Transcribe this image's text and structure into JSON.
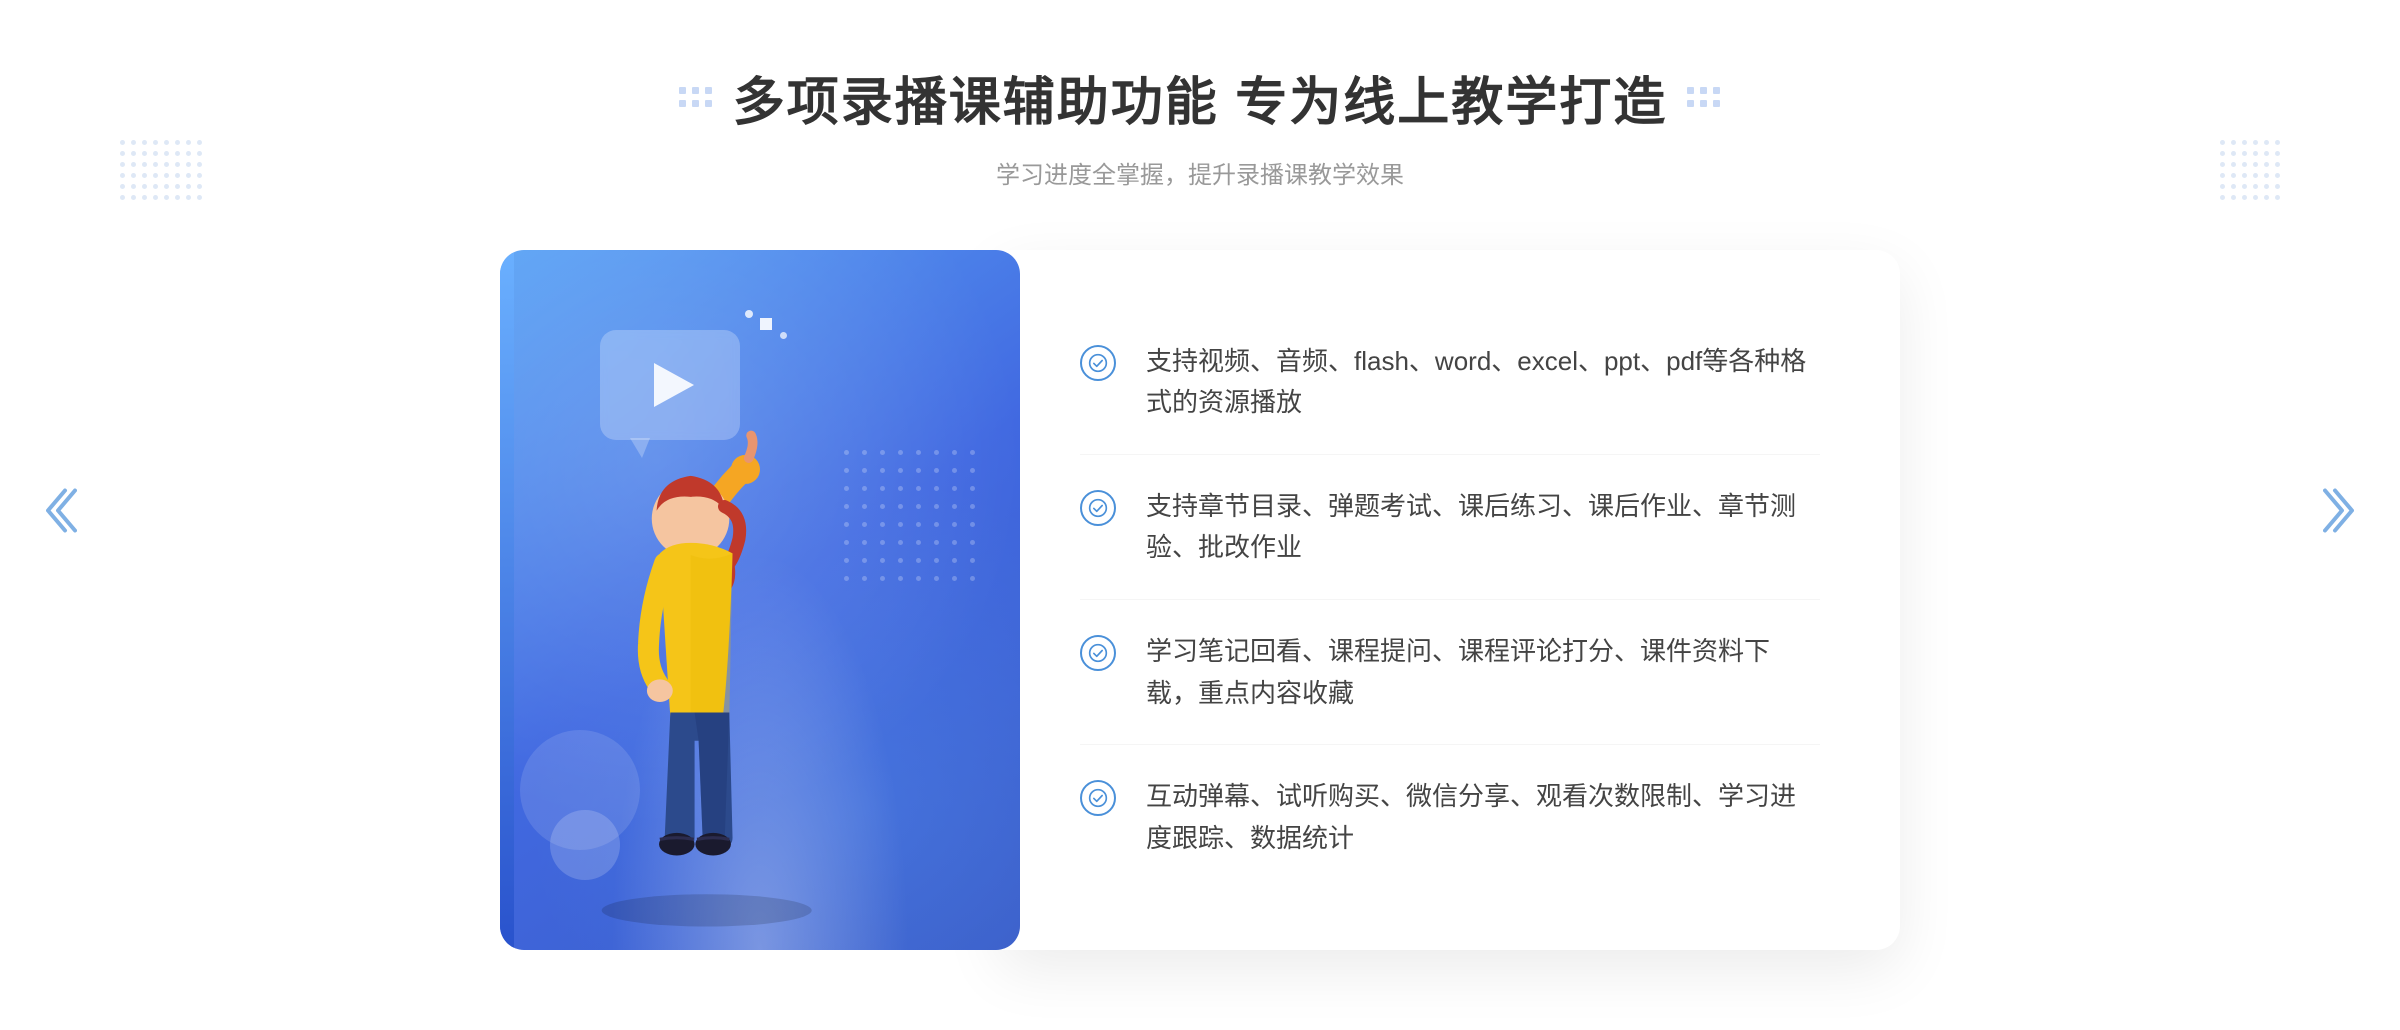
{
  "page": {
    "background": "#ffffff"
  },
  "header": {
    "title": "多项录播课辅助功能 专为线上教学打造",
    "subtitle": "学习进度全掌握，提升录播课教学效果",
    "title_deco_left": "⁞",
    "title_deco_right": "⁞"
  },
  "features": [
    {
      "id": 1,
      "text": "支持视频、音频、flash、word、excel、ppt、pdf等各种格式的资源播放"
    },
    {
      "id": 2,
      "text": "支持章节目录、弹题考试、课后练习、课后作业、章节测验、批改作业"
    },
    {
      "id": 3,
      "text": "学习笔记回看、课程提问、课程评论打分、课件资料下载，重点内容收藏"
    },
    {
      "id": 4,
      "text": "互动弹幕、试听购买、微信分享、观看次数限制、学习进度跟踪、数据统计"
    }
  ],
  "colors": {
    "accent_blue": "#4a90d9",
    "gradient_start": "#5ba3f5",
    "gradient_end": "#3a5bc7",
    "text_dark": "#333333",
    "text_light": "#999999",
    "feature_text": "#444444"
  },
  "illustration": {
    "play_label": "播放",
    "card_alt": "录播课辅助功能插图"
  }
}
